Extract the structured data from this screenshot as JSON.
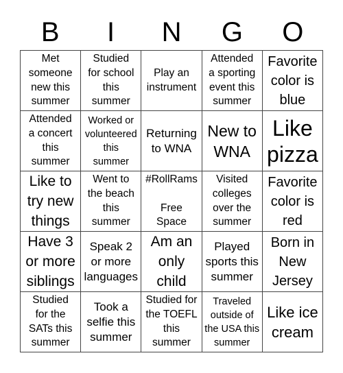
{
  "header": {
    "letters": [
      "B",
      "I",
      "N",
      "G",
      "O"
    ]
  },
  "cells": [
    {
      "text": "Met\nsomeone\nnew this\nsummer"
    },
    {
      "text": "Studied\nfor school\nthis\nsummer"
    },
    {
      "text": "Play an\ninstrument"
    },
    {
      "text": "Attended\na sporting\nevent this\nsummer"
    },
    {
      "text": "Favorite\ncolor is\nblue"
    },
    {
      "text": "Attended\na concert\nthis\nsummer"
    },
    {
      "text": "Worked or\nvolunteered\nthis\nsummer"
    },
    {
      "text": "Returning\nto WNA"
    },
    {
      "text": "New to\nWNA"
    },
    {
      "text": "Like\npizza"
    },
    {
      "text": "Like to\ntry new\nthings"
    },
    {
      "text": "Went to\nthe beach\nthis\nsummer"
    },
    {
      "text": "#RollRams\n\nFree\nSpace"
    },
    {
      "text": "Visited\ncolleges\nover the\nsummer"
    },
    {
      "text": "Favorite\ncolor is\nred"
    },
    {
      "text": "Have 3\nor more\nsiblings"
    },
    {
      "text": "Speak 2\nor more\nlanguages"
    },
    {
      "text": "Am an\nonly\nchild"
    },
    {
      "text": "Played\nsports this\nsummer"
    },
    {
      "text": "Born in\nNew\nJersey"
    },
    {
      "text": "Studied\nfor the\nSATs this\nsummer"
    },
    {
      "text": "Took a\nselfie this\nsummer"
    },
    {
      "text": "Studied for\nthe TOEFL\nthis\nsummer"
    },
    {
      "text": "Traveled\noutside of\nthe USA this\nsummer"
    },
    {
      "text": "Like ice\ncream"
    }
  ]
}
